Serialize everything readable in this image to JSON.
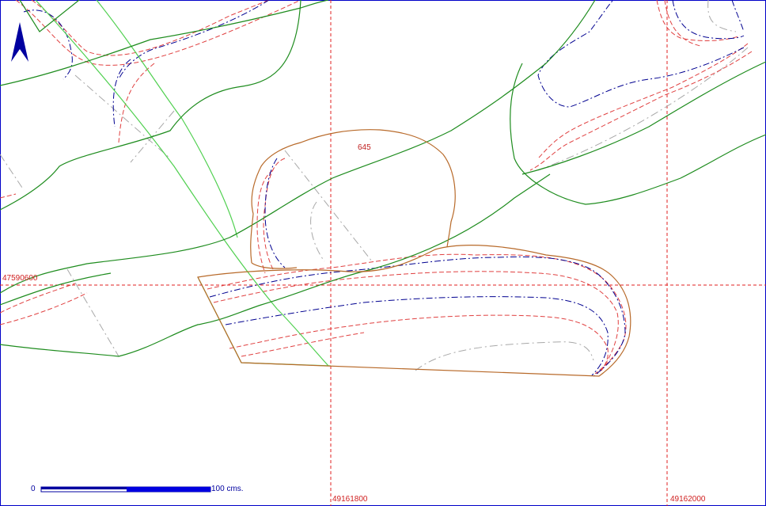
{
  "map": {
    "colors": {
      "frame": "#0000c8",
      "grid": "#e02020",
      "road_dark": "#1e8c1e",
      "road_light": "#40d040",
      "parcel": "#b86a2a",
      "contour_major": "#000090",
      "contour_minor": "#e04040",
      "contour_faint": "#a0a0a0"
    },
    "grid_labels": {
      "northing": "47590600",
      "easting_1": "49161800",
      "easting_2": "49162000"
    },
    "parcel_label": "645",
    "north_arrow_icon": "north-arrow-icon",
    "scale_bar": {
      "start_label": "0",
      "end_label": "100 cms."
    }
  }
}
